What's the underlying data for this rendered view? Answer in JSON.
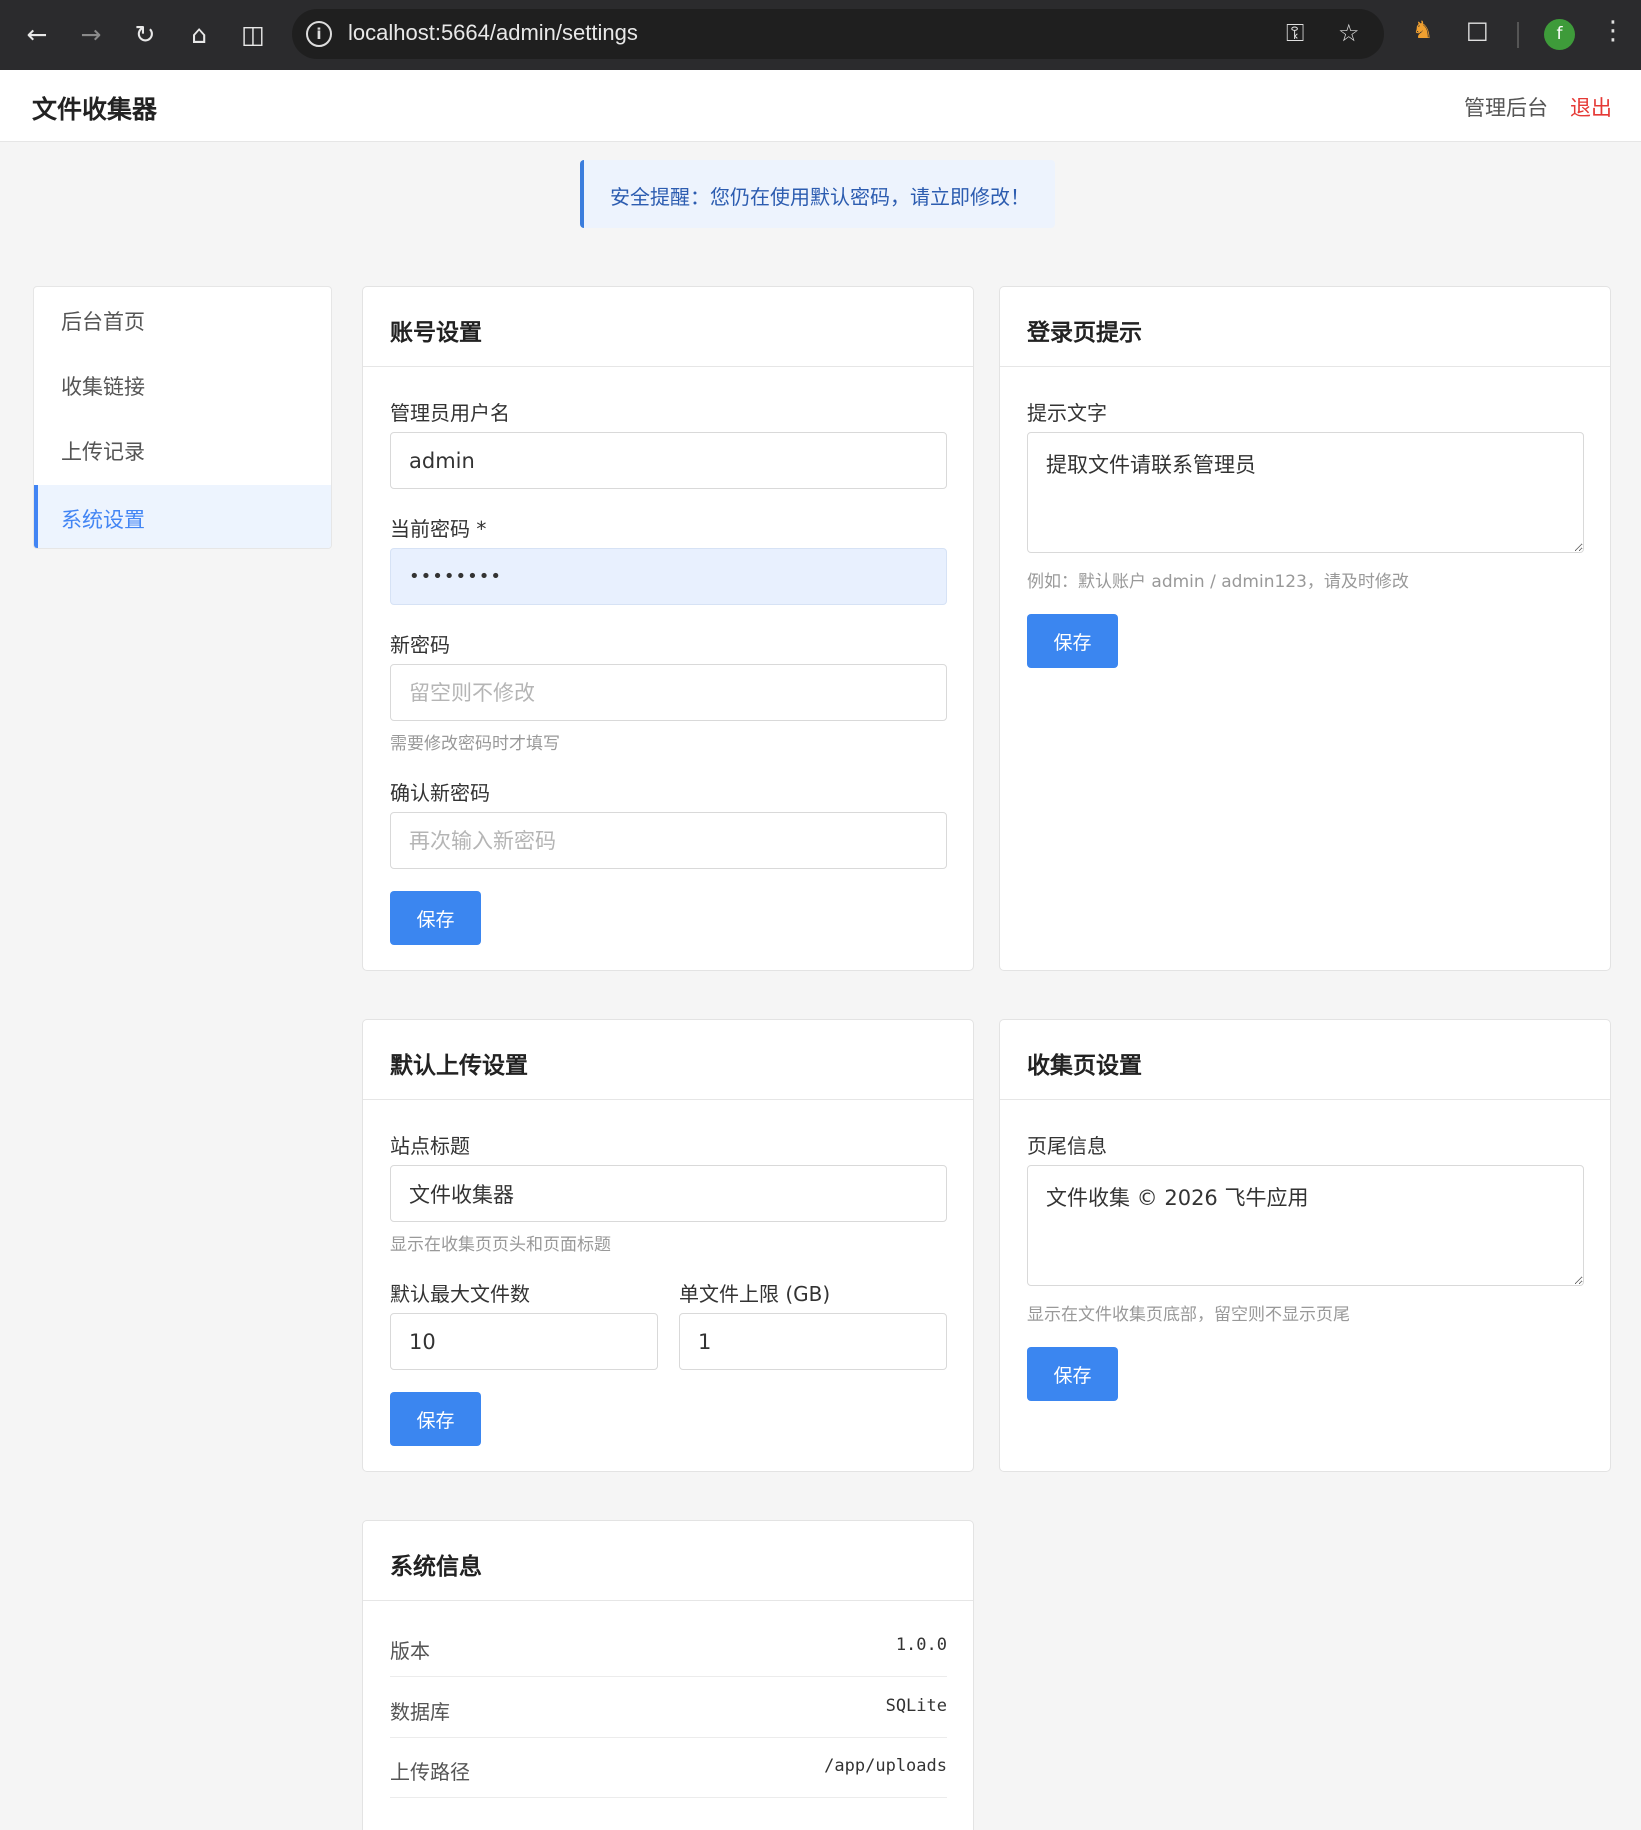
{
  "browser": {
    "url": "localhost:5664/admin/settings",
    "avatar_letter": "f"
  },
  "header": {
    "title": "文件收集器",
    "admin_link": "管理后台",
    "logout_link": "退出"
  },
  "alert": {
    "text": "安全提醒：您仍在使用默认密码，请立即修改！"
  },
  "sidebar": {
    "items": [
      {
        "label": "后台首页"
      },
      {
        "label": "收集链接"
      },
      {
        "label": "上传记录"
      },
      {
        "label": "系统设置"
      }
    ]
  },
  "account": {
    "title": "账号设置",
    "username_label": "管理员用户名",
    "username_value": "admin",
    "current_password_label": "当前密码 *",
    "current_password_value": "••••••••",
    "new_password_label": "新密码",
    "new_password_placeholder": "留空则不修改",
    "new_password_hint": "需要修改密码时才填写",
    "confirm_password_label": "确认新密码",
    "confirm_password_placeholder": "再次输入新密码",
    "save_label": "保存"
  },
  "login_tip": {
    "title": "登录页提示",
    "text_label": "提示文字",
    "text_value": "提取文件请联系管理员",
    "hint": "例如：默认账户 admin / admin123，请及时修改",
    "save_label": "保存"
  },
  "upload": {
    "title": "默认上传设置",
    "site_title_label": "站点标题",
    "site_title_value": "文件收集器",
    "site_title_hint": "显示在收集页页头和页面标题",
    "max_files_label": "默认最大文件数",
    "max_files_value": "10",
    "size_limit_label": "单文件上限 (GB)",
    "size_limit_value": "1",
    "save_label": "保存"
  },
  "collect_page": {
    "title": "收集页设置",
    "footer_label": "页尾信息",
    "footer_value": "文件收集 © 2026 飞牛应用",
    "footer_hint": "显示在文件收集页底部，留空则不显示页尾",
    "save_label": "保存"
  },
  "system_info": {
    "title": "系统信息",
    "rows": [
      {
        "key": "版本",
        "value": "1.0.0"
      },
      {
        "key": "数据库",
        "value": "SQLite"
      },
      {
        "key": "上传路径",
        "value": "/app/uploads"
      }
    ]
  }
}
